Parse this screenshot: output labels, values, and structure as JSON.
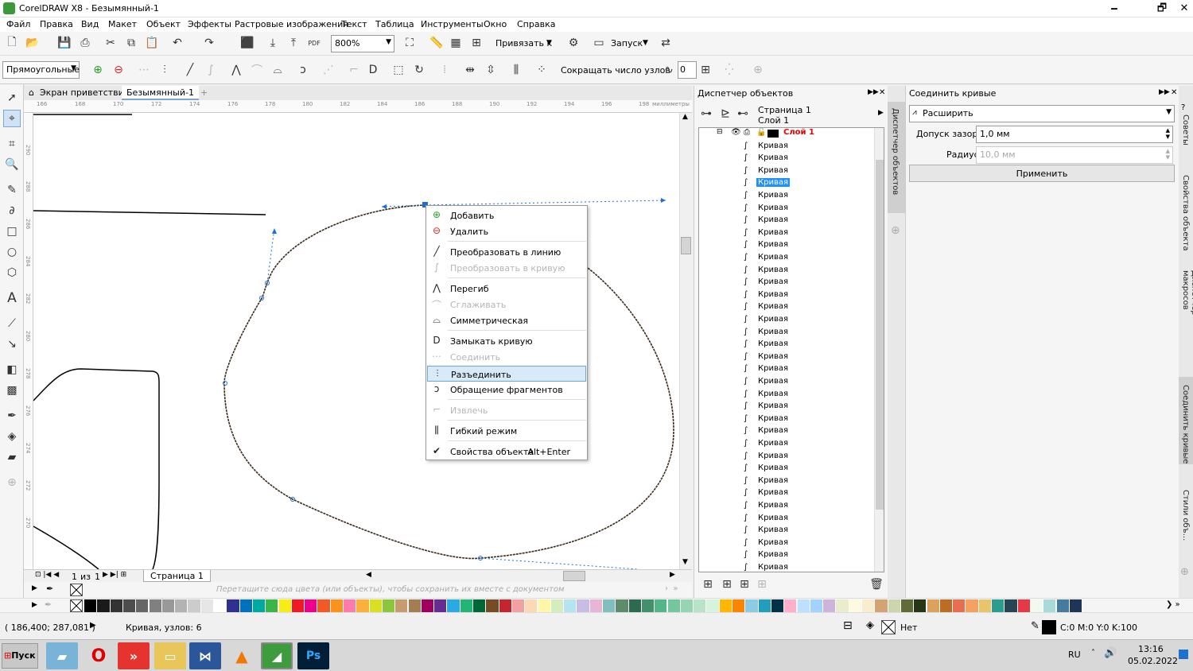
{
  "window": {
    "title": "CorelDRAW X8 - Безымянный-1",
    "minimize": "🗕",
    "restore": "🗗",
    "close": "✕"
  },
  "menu": [
    "Файл",
    "Правка",
    "Вид",
    "Макет",
    "Объект",
    "Эффекты",
    "Растровые изображения",
    "Текст",
    "Таблица",
    "Инструменты",
    "Окно",
    "Справка"
  ],
  "toolbar1": {
    "zoom": "800%",
    "snap_label": "Привязать к",
    "launch_label": "Запуск"
  },
  "toolbar2": {
    "mode": "Прямоугольные",
    "reduce_nodes_label": "Сокращать число узлов",
    "curve_smoothness": "0"
  },
  "doc_tabs": {
    "welcome": "Экран приветствия",
    "doc": "Безымянный-1",
    "add": "+"
  },
  "ruler": {
    "h_ticks": [
      "166",
      "168",
      "170",
      "172",
      "174",
      "176",
      "178",
      "180",
      "182",
      "184",
      "186",
      "188",
      "190",
      "192",
      "194",
      "196",
      "198"
    ],
    "unit": "миллиметры",
    "v_ticks": [
      "290",
      "288",
      "286",
      "284",
      "282",
      "280",
      "278",
      "276",
      "274",
      "272",
      "270"
    ]
  },
  "page_nav": {
    "current": "1",
    "of": "из",
    "total": "1",
    "page_tab": "Страница 1"
  },
  "doc_palette_hint": "Перетащите сюда цвета (или объекты), чтобы сохранить их вместе с документом",
  "context_menu": {
    "items": [
      {
        "label": "Добавить",
        "icon": "add-node-icon",
        "enabled": true
      },
      {
        "label": "Удалить",
        "icon": "delete-node-icon",
        "enabled": true
      },
      {
        "label": "Преобразовать в линию",
        "icon": "to-line-icon",
        "enabled": true
      },
      {
        "label": "Преобразовать в кривую",
        "icon": "to-curve-icon",
        "enabled": false
      },
      {
        "label": "Перегиб",
        "icon": "cusp-icon",
        "enabled": true
      },
      {
        "label": "Сглаживать",
        "icon": "smooth-icon",
        "enabled": false
      },
      {
        "label": "Симметрическая",
        "icon": "symmetric-icon",
        "enabled": true
      },
      {
        "label": "Замыкать кривую",
        "icon": "close-curve-icon",
        "enabled": true
      },
      {
        "label": "Соединить",
        "icon": "join-icon",
        "enabled": false
      },
      {
        "label": "Разъединить",
        "icon": "break-icon",
        "enabled": true
      },
      {
        "label": "Обращение фрагментов",
        "icon": "reverse-icon",
        "enabled": true
      },
      {
        "label": "Извлечь",
        "icon": "extract-icon",
        "enabled": false
      },
      {
        "label": "Гибкий режим",
        "icon": "elastic-icon",
        "enabled": true
      },
      {
        "label": "Свойства объекта",
        "icon": "checkmark-icon",
        "enabled": true,
        "shortcut": "Alt+Enter"
      }
    ]
  },
  "object_manager": {
    "title": "Диспетчер объектов",
    "page": "Страница 1",
    "layer": "Слой 1",
    "layer_node": "Слой 1",
    "item_label": "Кривая",
    "items": [
      "Кривая",
      "Кривая",
      "Кривая",
      "Кривая",
      "Кривая",
      "Кривая",
      "Кривая",
      "Кривая",
      "Кривая",
      "Кривая",
      "Кривая",
      "Кривая",
      "Кривая",
      "Кривая",
      "Кривая",
      "Кривая",
      "Кривая",
      "Кривая",
      "Кривая",
      "Кривая",
      "Кривая",
      "Кривая",
      "Кривая",
      "Кривая",
      "Кривая",
      "Кривая",
      "Кривая",
      "Кривая",
      "Кривая",
      "Кривая",
      "Кривая",
      "Кривая",
      "Кривая",
      "Кривая",
      "Кривая"
    ],
    "selected_index": 3,
    "side_tab": "Диспетчер объектов"
  },
  "join_panel": {
    "title": "Соединить кривые",
    "method": "Расширить",
    "gap_label": "Допуск зазора:",
    "gap_value": "1,0 мм",
    "radius_label": "Радиус:",
    "radius_value": "10,0 мм",
    "apply": "Применить",
    "side_tabs": [
      "Советы",
      "Свойства объекта",
      "Диспетчер макросов",
      "Соединить кривые",
      "Стили объ..."
    ]
  },
  "status": {
    "coords": "( 186,400; 287,081 )",
    "info": "Кривая, узлов: 6",
    "fill": "Нет",
    "color": "C:0 M:0 Y:0 K:100"
  },
  "taskbar": {
    "start": "Пуск",
    "lang": "RU",
    "time": "13:16",
    "date": "05.02.2022",
    "apps": [
      "desk-app",
      "opera",
      "anydesk",
      "explorer",
      "vscode",
      "vlc",
      "coreldraw",
      "photoshop"
    ],
    "ps": "Ps"
  },
  "palette": [
    "#000000",
    "#1a1a1a",
    "#333333",
    "#4d4d4d",
    "#666666",
    "#808080",
    "#999999",
    "#b3b3b3",
    "#cccccc",
    "#e6e6e6",
    "#ffffff",
    "#2e3192",
    "#0071bc",
    "#00a99d",
    "#39b54a",
    "#f7ec13",
    "#ed1c24",
    "#ec008c",
    "#f15a24",
    "#f7931e",
    "#ff7bac",
    "#fbb03b",
    "#d9e021",
    "#8cc63f",
    "#c69c6d",
    "#a67c52",
    "#9e005d",
    "#662d91",
    "#29abe2",
    "#22b573",
    "#006837",
    "#754c24",
    "#c1272d",
    "#f2a0a0",
    "#fcd9b5",
    "#fff6a6",
    "#d4edbf",
    "#b5e3f0",
    "#c9bde8",
    "#e8b5d8",
    "#7fbfbf",
    "#5e8c6a",
    "#2d6a4f",
    "#40916c",
    "#52b788",
    "#74c69d",
    "#95d5b2",
    "#b7e4c7",
    "#d8f3dc",
    "#ffb703",
    "#fb8500",
    "#8ecae6",
    "#219ebc",
    "#023047",
    "#ffafcc",
    "#bde0fe",
    "#a2d2ff",
    "#cdb4db",
    "#e9edc9",
    "#fefae0",
    "#faedcd",
    "#d4a373",
    "#ccd5ae",
    "#606c38",
    "#283618",
    "#dda15e",
    "#bc6c25",
    "#e76f51",
    "#f4a261",
    "#e9c46a",
    "#2a9d8f",
    "#264653",
    "#e63946",
    "#f1faee",
    "#a8dadc",
    "#457b9d",
    "#1d3557"
  ]
}
